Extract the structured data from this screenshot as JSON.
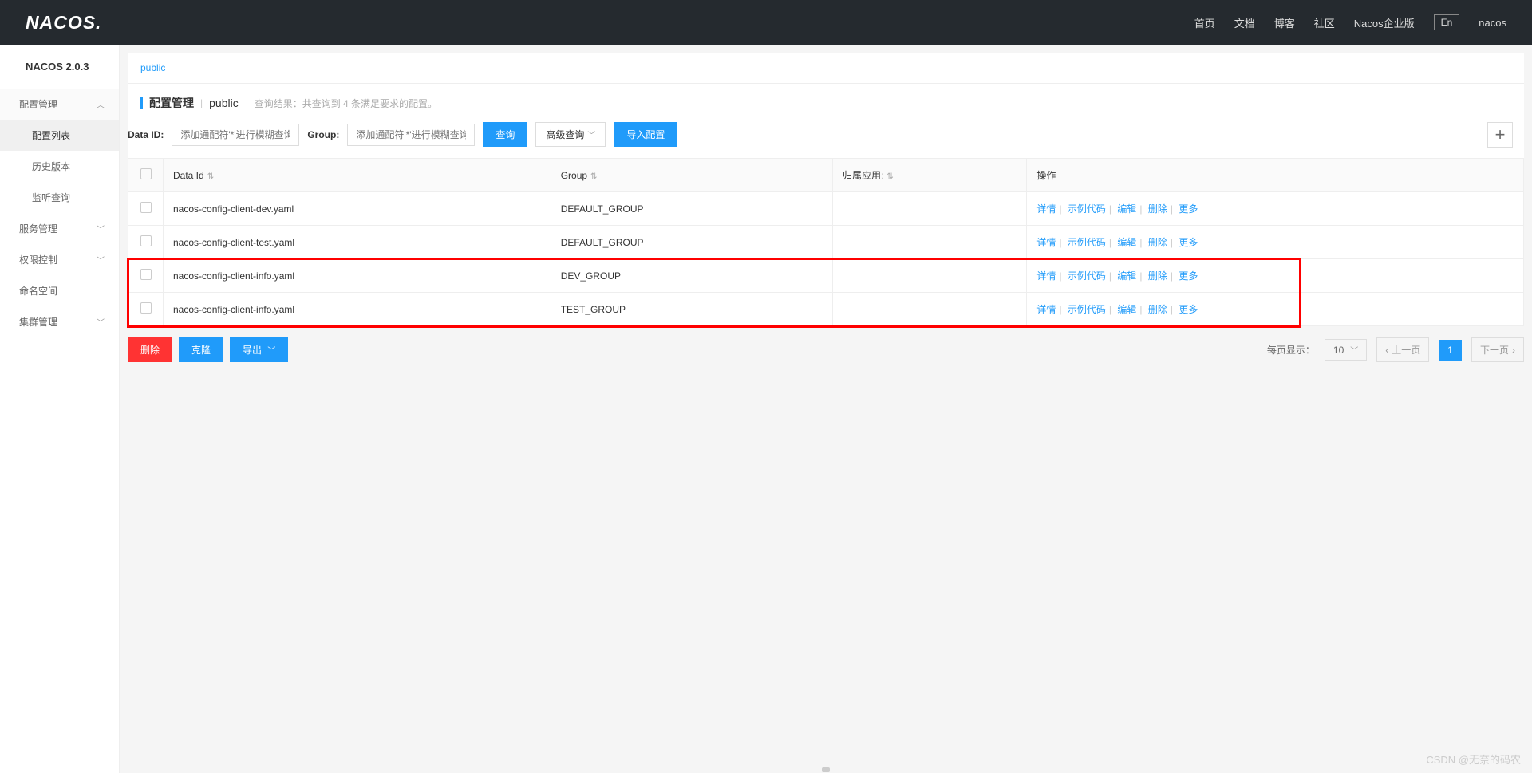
{
  "header": {
    "logo": "NACOS.",
    "nav": [
      "首页",
      "文档",
      "博客",
      "社区",
      "Nacos企业版"
    ],
    "lang": "En",
    "user": "nacos"
  },
  "sidebar": {
    "title": "NACOS 2.0.3",
    "items": [
      {
        "label": "配置管理",
        "expanded": true,
        "children": [
          {
            "label": "配置列表",
            "active": true
          },
          {
            "label": "历史版本"
          },
          {
            "label": "监听查询"
          }
        ]
      },
      {
        "label": "服务管理"
      },
      {
        "label": "权限控制"
      },
      {
        "label": "命名空间"
      },
      {
        "label": "集群管理"
      }
    ]
  },
  "namespace": {
    "tab": "public"
  },
  "pageTitle": {
    "main": "配置管理",
    "sub": "public",
    "result": "查询结果：共查询到 4 条满足要求的配置。"
  },
  "search": {
    "dataIdLabel": "Data ID:",
    "dataIdPlaceholder": "添加通配符'*'进行模糊查询",
    "groupLabel": "Group:",
    "groupPlaceholder": "添加通配符'*'进行模糊查询",
    "queryBtn": "查询",
    "advancedBtn": "高级查询",
    "importBtn": "导入配置"
  },
  "table": {
    "headers": {
      "dataId": "Data Id",
      "group": "Group",
      "app": "归属应用:",
      "action": "操作"
    },
    "rows": [
      {
        "dataId": "nacos-config-client-dev.yaml",
        "group": "DEFAULT_GROUP",
        "app": "",
        "highlighted": false
      },
      {
        "dataId": "nacos-config-client-test.yaml",
        "group": "DEFAULT_GROUP",
        "app": "",
        "highlighted": false
      },
      {
        "dataId": "nacos-config-client-info.yaml",
        "group": "DEV_GROUP",
        "app": "",
        "highlighted": true
      },
      {
        "dataId": "nacos-config-client-info.yaml",
        "group": "TEST_GROUP",
        "app": "",
        "highlighted": true
      }
    ],
    "actions": {
      "detail": "详情",
      "sample": "示例代码",
      "edit": "编辑",
      "delete": "删除",
      "more": "更多"
    }
  },
  "footer": {
    "deleteBtn": "删除",
    "cloneBtn": "克隆",
    "exportBtn": "导出",
    "perPageLabel": "每页显示：",
    "perPageValue": "10",
    "prev": "上一页",
    "current": "1",
    "next": "下一页"
  },
  "watermark": "CSDN @无奈的码农"
}
